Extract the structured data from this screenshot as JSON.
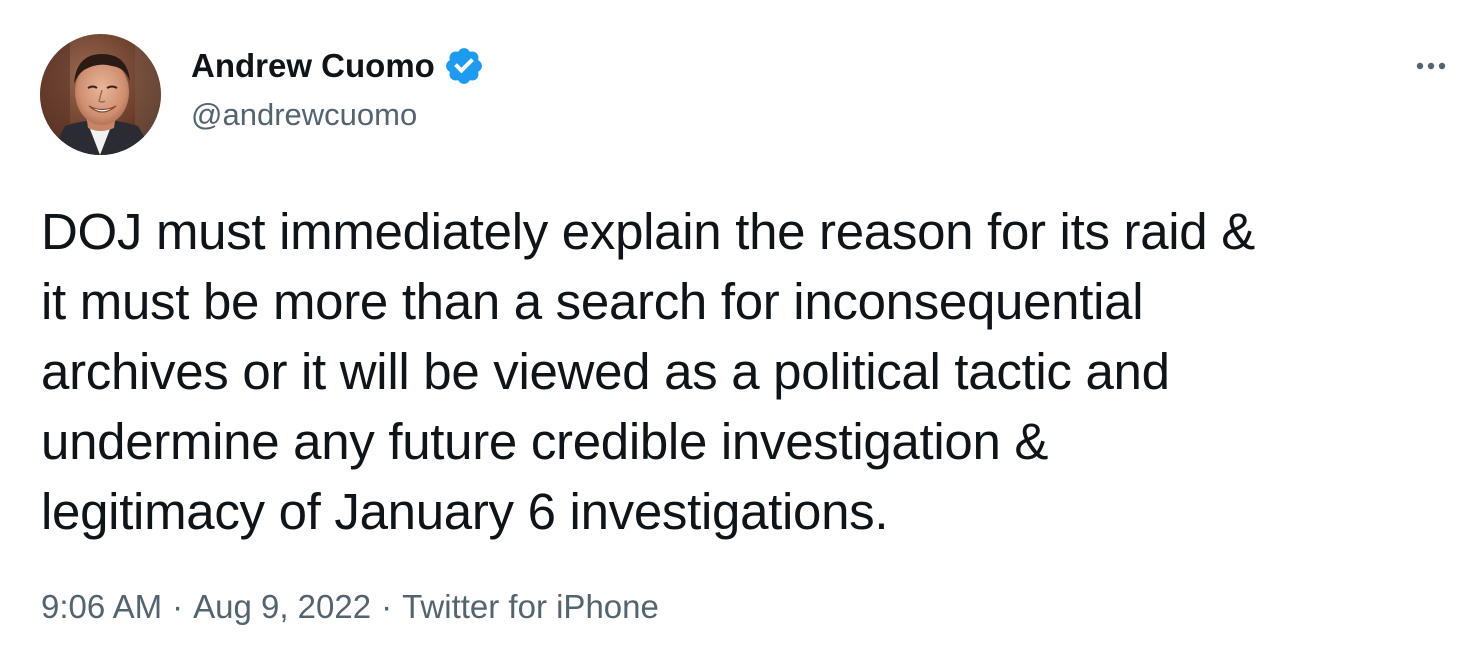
{
  "author": {
    "display_name": "Andrew Cuomo",
    "handle": "@andrewcuomo",
    "verified": true,
    "verified_color": "#1d9bf0"
  },
  "menu": {
    "icon": "more-horizontal-icon"
  },
  "tweet": {
    "text_lines": [
      "DOJ must immediately explain the reason for its raid &",
      "it must be more than a search for inconsequential",
      "archives or it will be viewed as a political tactic and",
      "undermine any future credible investigation &",
      "legitimacy of January 6 investigations."
    ]
  },
  "meta": {
    "time": "9:06 AM",
    "separator": "·",
    "date": "Aug 9, 2022",
    "source": "Twitter for iPhone"
  },
  "colors": {
    "text_primary": "#0f1419",
    "text_secondary": "#536471",
    "accent": "#1d9bf0"
  }
}
